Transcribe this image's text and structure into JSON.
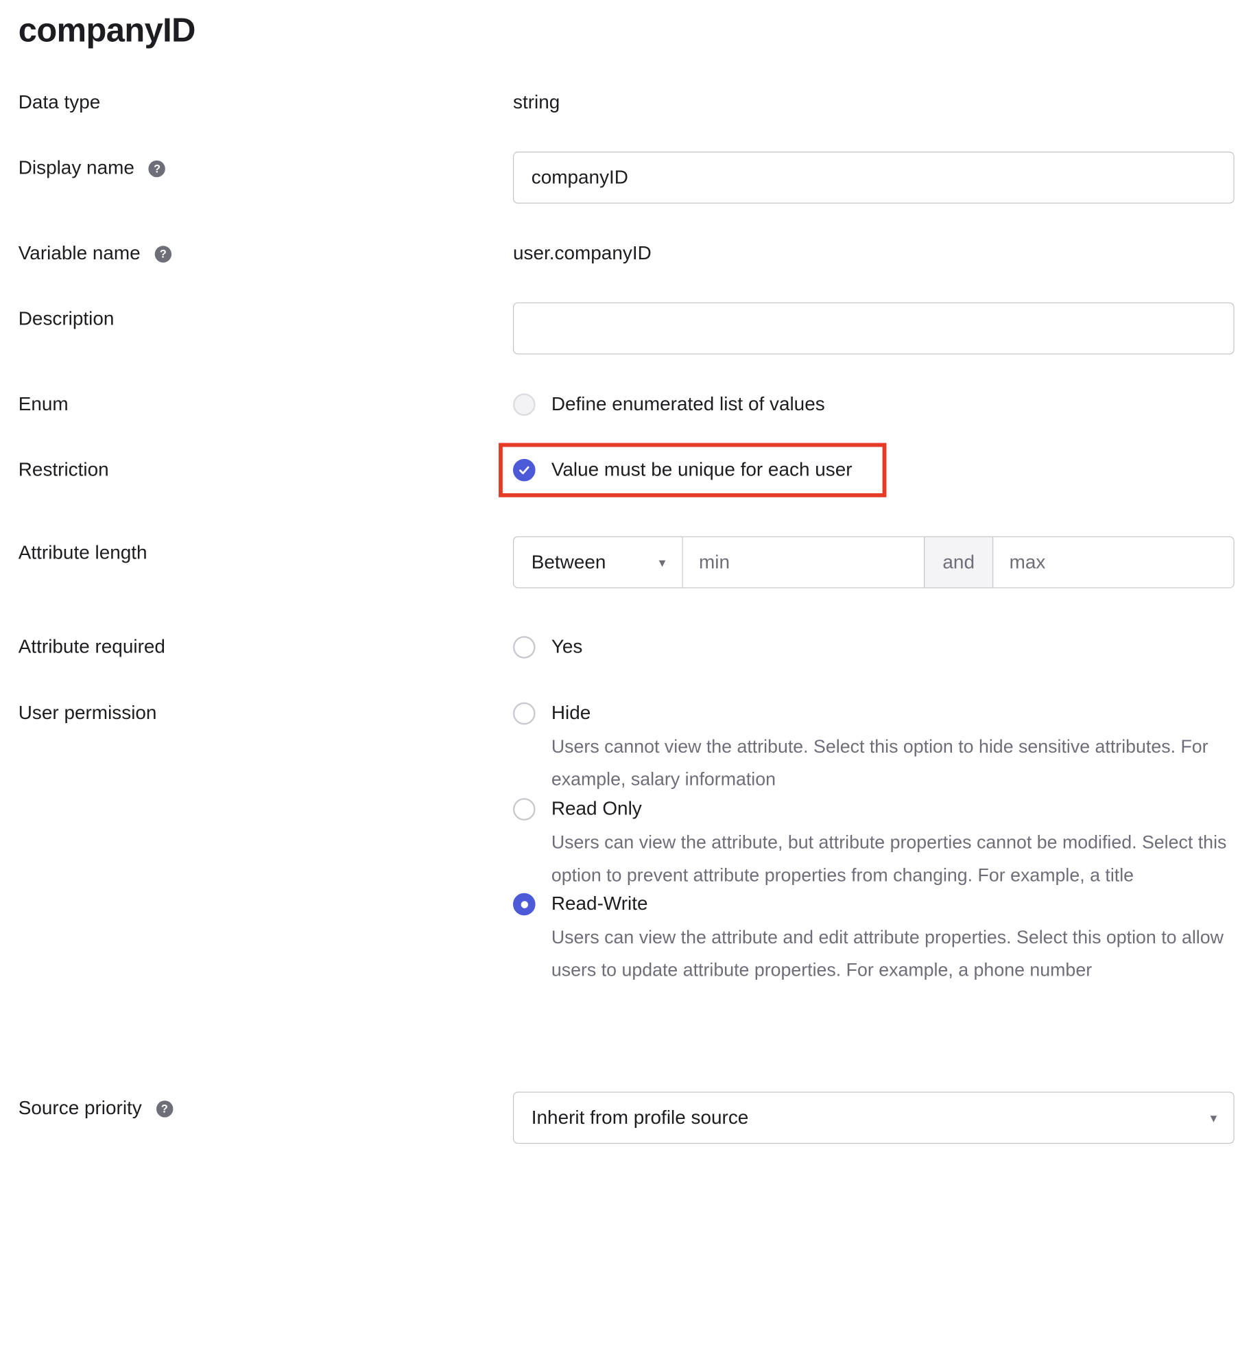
{
  "title": "companyID",
  "fields": {
    "data_type": {
      "label": "Data type",
      "value": "string"
    },
    "display_name": {
      "label": "Display name",
      "value": "companyID"
    },
    "variable_name": {
      "label": "Variable name",
      "value": "user.companyID"
    },
    "description": {
      "label": "Description",
      "value": ""
    },
    "enum": {
      "label": "Enum",
      "checkbox_label": "Define enumerated list of values",
      "checked": false
    },
    "restriction": {
      "label": "Restriction",
      "checkbox_label": "Value must be unique for each user",
      "checked": true
    },
    "attribute_length": {
      "label": "Attribute length",
      "operator": "Between",
      "min_placeholder": "min",
      "and_label": "and",
      "max_placeholder": "max"
    },
    "attribute_required": {
      "label": "Attribute required",
      "checkbox_label": "Yes",
      "checked": false
    },
    "user_permission": {
      "label": "User permission",
      "selected": "Read-Write",
      "options": [
        {
          "label": "Hide",
          "description": "Users cannot view the attribute. Select this option to hide sensitive attributes. For example, salary information"
        },
        {
          "label": "Read Only",
          "description": "Users can view the attribute, but attribute properties cannot be modified. Select this option to prevent attribute properties from changing. For example, a title"
        },
        {
          "label": "Read-Write",
          "description": "Users can view the attribute and edit attribute properties. Select this option to allow users to update attribute properties. For example, a phone number"
        }
      ]
    },
    "source_priority": {
      "label": "Source priority",
      "value": "Inherit from profile source"
    }
  },
  "icons": {
    "help": "question-mark-circle-icon",
    "checkmark": "checkmark-icon",
    "dropdown": "caret-down-icon"
  },
  "colors": {
    "accent": "#4c5ad8",
    "highlight": "#e53a25",
    "muted_text": "#6e6e78"
  }
}
